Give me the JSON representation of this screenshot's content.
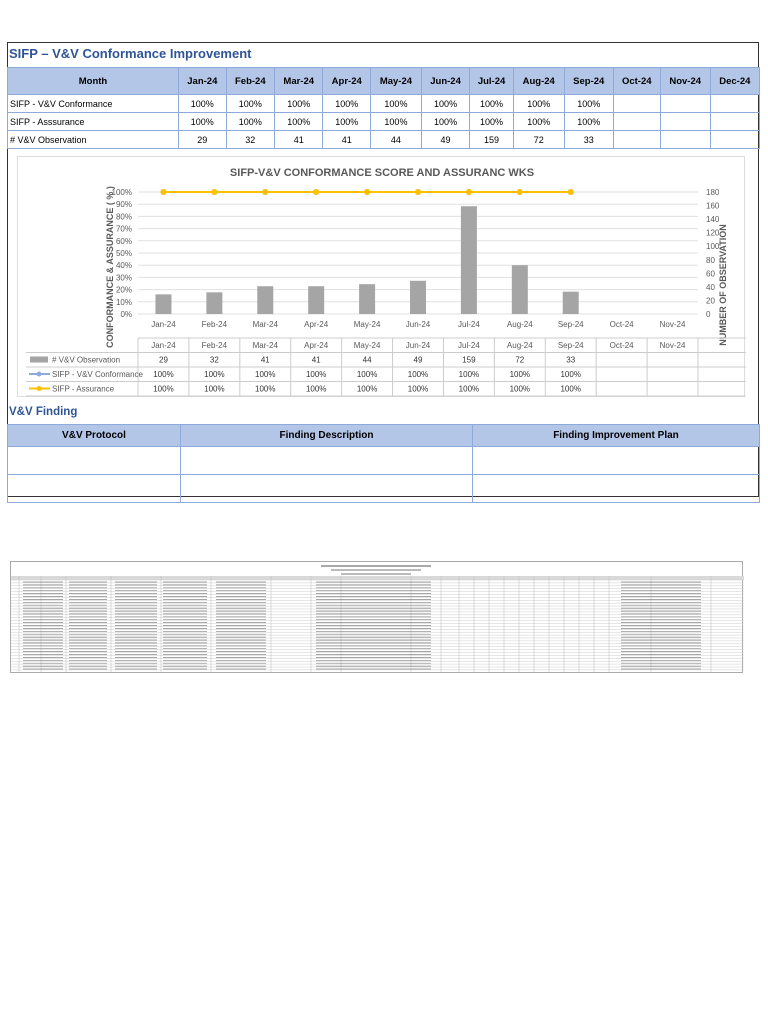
{
  "title": "SIFP – V&V Conformance Improvement",
  "table": {
    "header_label": "Month",
    "months": [
      "Jan-24",
      "Feb-24",
      "Mar-24",
      "Apr-24",
      "May-24",
      "Jun-24",
      "Jul-24",
      "Aug-24",
      "Sep-24",
      "Oct-24",
      "Nov-24",
      "Dec-24"
    ],
    "rows": [
      {
        "label": "SIFP - V&V Conformance",
        "values": [
          "100%",
          "100%",
          "100%",
          "100%",
          "100%",
          "100%",
          "100%",
          "100%",
          "100%",
          "",
          "",
          ""
        ]
      },
      {
        "label": "SIFP - Asssurance",
        "values": [
          "100%",
          "100%",
          "100%",
          "100%",
          "100%",
          "100%",
          "100%",
          "100%",
          "100%",
          "",
          "",
          ""
        ]
      },
      {
        "label": "# V&V Observation",
        "values": [
          "29",
          "32",
          "41",
          "41",
          "44",
          "49",
          "159",
          "72",
          "33",
          "",
          "",
          ""
        ]
      }
    ]
  },
  "chart_data": {
    "type": "bar",
    "title": "SIFP-V&V CONFORMANCE SCORE AND ASSURANC WKS",
    "ylabel": "CONFORMANCE & ASSURANCE ( % )",
    "y2label": "NUMBER OF OBSERVATION",
    "categories": [
      "Jan-24",
      "Feb-24",
      "Mar-24",
      "Apr-24",
      "May-24",
      "Jun-24",
      "Jul-24",
      "Aug-24",
      "Sep-24",
      "Oct-24",
      "Nov-24"
    ],
    "ylim": [
      0,
      100
    ],
    "y2lim": [
      0,
      180
    ],
    "yticks": [
      "0%",
      "10%",
      "20%",
      "30%",
      "40%",
      "50%",
      "60%",
      "70%",
      "80%",
      "90%",
      "100%"
    ],
    "y2ticks": [
      "0",
      "20",
      "40",
      "60",
      "80",
      "100",
      "120",
      "140",
      "160",
      "180"
    ],
    "series": [
      {
        "name": "# V&V Observation",
        "type": "bar",
        "axis": "right",
        "color": "#a5a5a5",
        "values": [
          29,
          32,
          41,
          41,
          44,
          49,
          159,
          72,
          33,
          null,
          null
        ],
        "labels": [
          "29",
          "32",
          "41",
          "41",
          "44",
          "49",
          "159",
          "72",
          "33",
          "",
          ""
        ]
      },
      {
        "name": "SIFP - V&V Conformance",
        "type": "line",
        "axis": "left",
        "color": "#8faadc",
        "values": [
          100,
          100,
          100,
          100,
          100,
          100,
          100,
          100,
          100,
          null,
          null
        ],
        "labels": [
          "100%",
          "100%",
          "100%",
          "100%",
          "100%",
          "100%",
          "100%",
          "100%",
          "100%",
          "",
          ""
        ]
      },
      {
        "name": "SIFP - Assurance",
        "type": "line",
        "axis": "left",
        "color": "#ffc000",
        "values": [
          100,
          100,
          100,
          100,
          100,
          100,
          100,
          100,
          100,
          null,
          null
        ],
        "labels": [
          "100%",
          "100%",
          "100%",
          "100%",
          "100%",
          "100%",
          "100%",
          "100%",
          "100%",
          "",
          ""
        ]
      }
    ]
  },
  "finding": {
    "title": "V&V Finding",
    "columns": [
      "V&V Protocol",
      "Finding Description",
      "Finding Improvement Plan"
    ]
  }
}
